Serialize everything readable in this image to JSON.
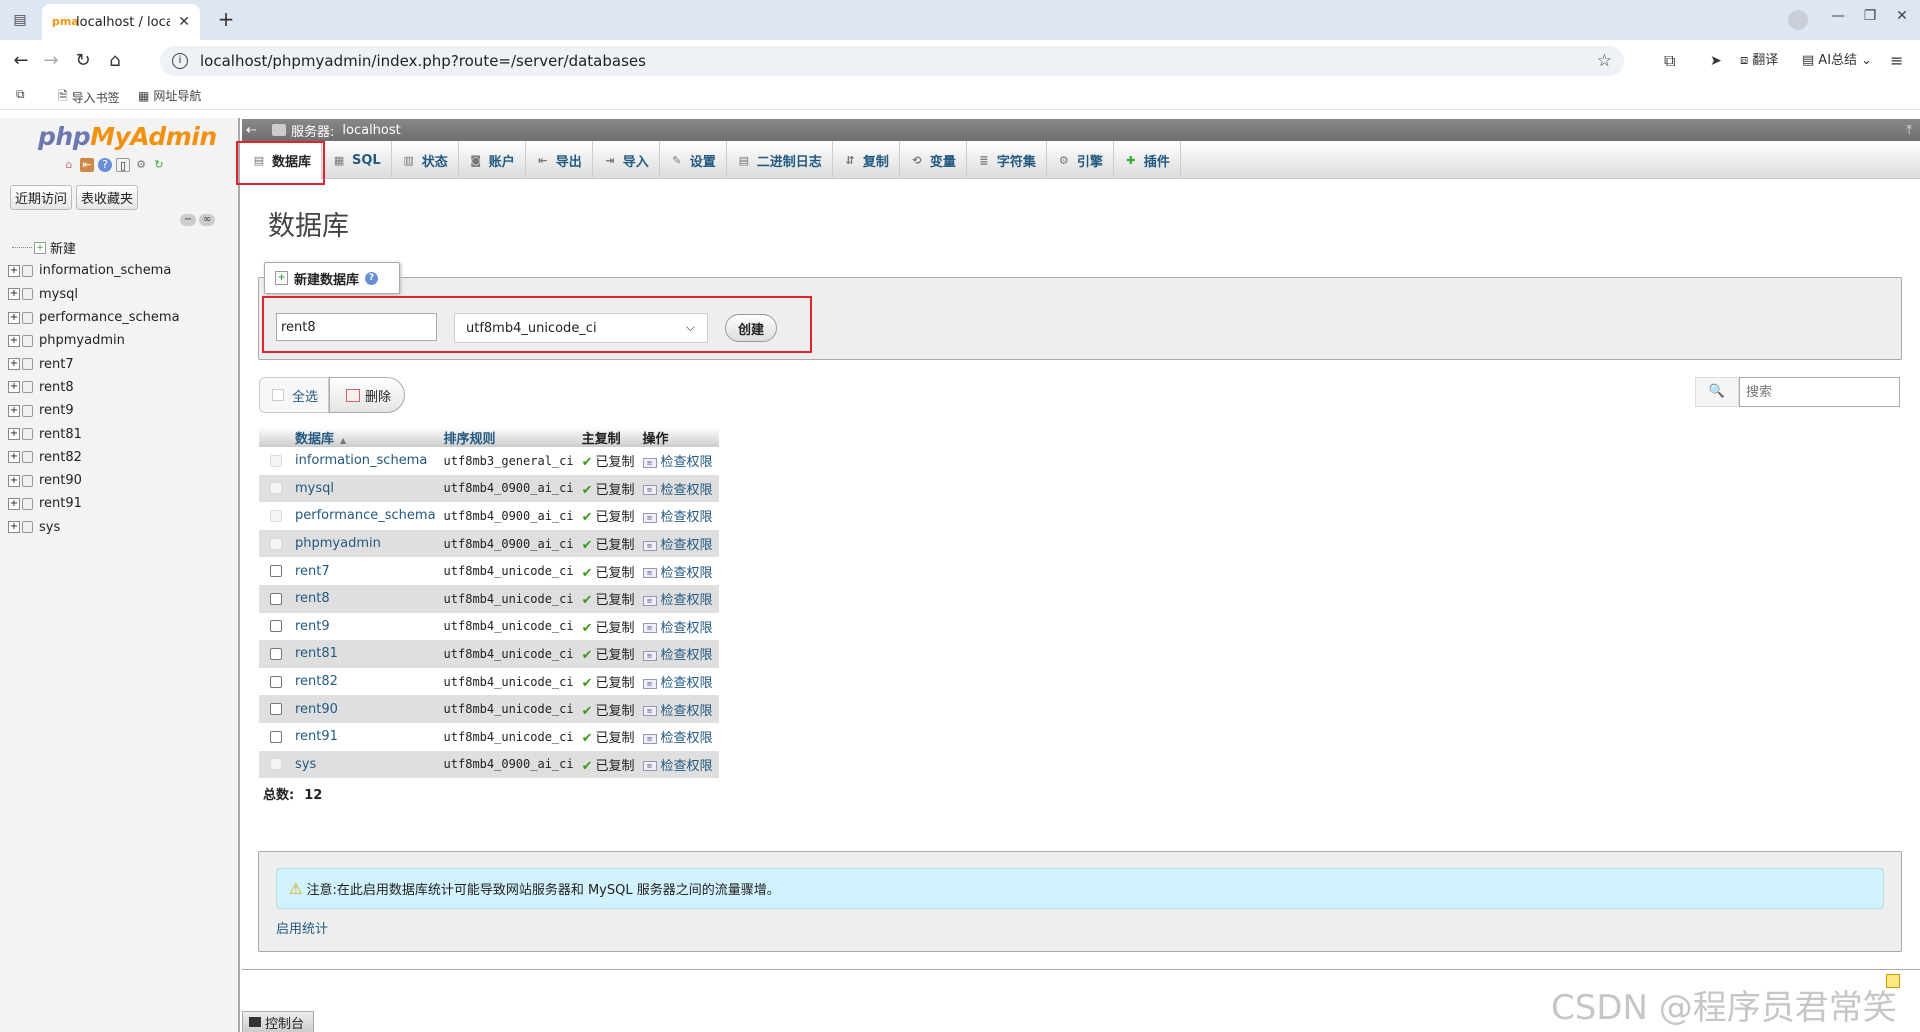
{
  "browser": {
    "tab_title": "localhost / localhost",
    "favicon_text": "pma",
    "url": "localhost/phpmyadmin/index.php?route=/server/databases",
    "translate_label": "翻译",
    "ai_label": "AI总结"
  },
  "bookmarks": {
    "import_label": "导入书签",
    "nav_label": "网址导航"
  },
  "leftpanel": {
    "logo_php": "php",
    "logo_myadmin": "MyAdmin",
    "recent_label": "近期访问",
    "favorites_label": "表收藏夹",
    "new_label": "新建",
    "databases": [
      "information_schema",
      "mysql",
      "performance_schema",
      "phpmyadmin",
      "rent7",
      "rent8",
      "rent9",
      "rent81",
      "rent82",
      "rent90",
      "rent91",
      "sys"
    ]
  },
  "serverbar": {
    "label": "服务器:",
    "server": "localhost"
  },
  "topmenu": [
    {
      "label": "数据库",
      "icon": "database-icon",
      "active": true
    },
    {
      "label": "SQL",
      "icon": "sql-icon"
    },
    {
      "label": "状态",
      "icon": "status-icon"
    },
    {
      "label": "账户",
      "icon": "users-icon"
    },
    {
      "label": "导出",
      "icon": "export-icon"
    },
    {
      "label": "导入",
      "icon": "import-icon"
    },
    {
      "label": "设置",
      "icon": "settings-icon"
    },
    {
      "label": "二进制日志",
      "icon": "binlog-icon"
    },
    {
      "label": "复制",
      "icon": "replication-icon"
    },
    {
      "label": "变量",
      "icon": "variables-icon"
    },
    {
      "label": "字符集",
      "icon": "charset-icon"
    },
    {
      "label": "引擎",
      "icon": "engine-icon"
    },
    {
      "label": "插件",
      "icon": "plugin-icon"
    }
  ],
  "page": {
    "title": "数据库"
  },
  "create": {
    "legend": "新建数据库",
    "name_value": "rent8",
    "collation_value": "utf8mb4_unicode_ci",
    "button": "创建"
  },
  "toolbar": {
    "select_all": "全选",
    "delete": "删除",
    "search_placeholder": "搜索"
  },
  "table": {
    "headers": {
      "name": "数据库",
      "collation": "排序规则",
      "replication": "主复制",
      "action": "操作"
    },
    "rows": [
      {
        "name": "information_schema",
        "collation": "utf8mb3_general_ci",
        "replication": "已复制",
        "action": "检查权限",
        "checkbox_enabled": false
      },
      {
        "name": "mysql",
        "collation": "utf8mb4_0900_ai_ci",
        "replication": "已复制",
        "action": "检查权限",
        "checkbox_enabled": false
      },
      {
        "name": "performance_schema",
        "collation": "utf8mb4_0900_ai_ci",
        "replication": "已复制",
        "action": "检查权限",
        "checkbox_enabled": false
      },
      {
        "name": "phpmyadmin",
        "collation": "utf8mb4_0900_ai_ci",
        "replication": "已复制",
        "action": "检查权限",
        "checkbox_enabled": false
      },
      {
        "name": "rent7",
        "collation": "utf8mb4_unicode_ci",
        "replication": "已复制",
        "action": "检查权限",
        "checkbox_enabled": true
      },
      {
        "name": "rent8",
        "collation": "utf8mb4_unicode_ci",
        "replication": "已复制",
        "action": "检查权限",
        "checkbox_enabled": true
      },
      {
        "name": "rent9",
        "collation": "utf8mb4_unicode_ci",
        "replication": "已复制",
        "action": "检查权限",
        "checkbox_enabled": true
      },
      {
        "name": "rent81",
        "collation": "utf8mb4_unicode_ci",
        "replication": "已复制",
        "action": "检查权限",
        "checkbox_enabled": true
      },
      {
        "name": "rent82",
        "collation": "utf8mb4_unicode_ci",
        "replication": "已复制",
        "action": "检查权限",
        "checkbox_enabled": true
      },
      {
        "name": "rent90",
        "collation": "utf8mb4_unicode_ci",
        "replication": "已复制",
        "action": "检查权限",
        "checkbox_enabled": true
      },
      {
        "name": "rent91",
        "collation": "utf8mb4_unicode_ci",
        "replication": "已复制",
        "action": "检查权限",
        "checkbox_enabled": true
      },
      {
        "name": "sys",
        "collation": "utf8mb4_0900_ai_ci",
        "replication": "已复制",
        "action": "检查权限",
        "checkbox_enabled": false
      }
    ],
    "total_label": "总数:",
    "total_value": "12"
  },
  "notice": {
    "text": "注意:在此启用数据库统计可能导致网站服务器和 MySQL 服务器之间的流量骤增。",
    "enable_stats": "启用统计"
  },
  "console": {
    "label": "控制台"
  },
  "watermark": "CSDN @程序员君常笑"
}
